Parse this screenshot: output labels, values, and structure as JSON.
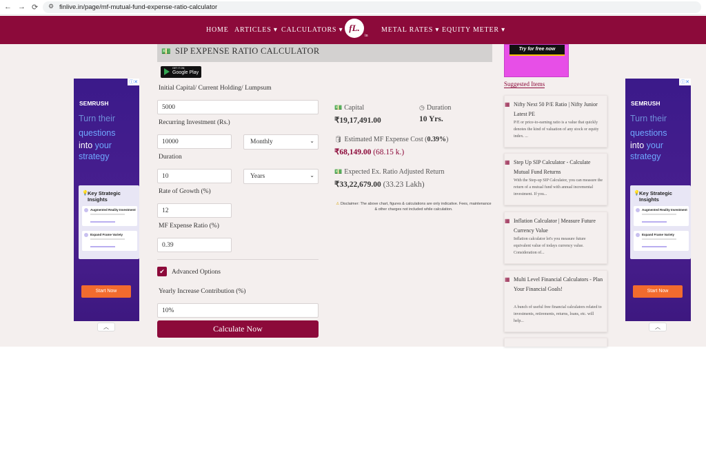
{
  "browser": {
    "url": "finlive.in/page/mf-mutual-fund-expense-ratio-calculator",
    "back": "←",
    "forward": "→",
    "reload": "⟳"
  },
  "nav": {
    "items": [
      "HOME",
      "ARTICLES ▾",
      "CALCULATORS ▾",
      "METAL RATES ▾",
      "EQUITY METER ▾"
    ],
    "logo": "fL.",
    "logo_sub": "in"
  },
  "calculator": {
    "title": "SIP EXPENSE RATIO CALCULATOR",
    "google_play_top": "GET IT ON",
    "google_play": "Google Play",
    "fields": {
      "initial_capital_label": "Initial Capital/ Current Holding/ Lumpsum",
      "initial_capital_value": "5000",
      "recurring_label": "Recurring Investment (Rs.)",
      "recurring_value": "10000",
      "recurring_frequency": "Monthly",
      "duration_label": "Duration",
      "duration_value": "10",
      "duration_unit": "Years",
      "growth_label": "Rate of Growth (%)",
      "growth_value": "12",
      "expense_label": "MF Expense Ratio (%)",
      "expense_value": "0.39",
      "advanced_label": "Advanced Options",
      "yearly_increase_label": "Yearly Increase Contribution (%)",
      "yearly_increase_value": "10%"
    },
    "calculate_label": "Calculate Now"
  },
  "results": {
    "capital_label": "Capital",
    "capital_value": "₹19,17,491.00",
    "duration_label": "Duration",
    "duration_value": "10 Yrs.",
    "expense_cost_label_prefix": "Estimated MF Expense Cost (",
    "expense_cost_pct": "0.39%",
    "expense_cost_label_suffix": ")",
    "expense_cost_value": "₹68,149.00",
    "expense_cost_short": "(68.15 k.)",
    "adjusted_label": "Expected Ex. Ratio Adjusted Return",
    "adjusted_value": "₹33,22,679.00",
    "adjusted_short": "(33.23 Lakh)",
    "disclaimer": "Disclaimer: The above chart, figures & calculations are only indicative. Fees, maintenance & other charges not included while calculation."
  },
  "ads": {
    "brand": "SEMRUSH",
    "line1": "Turn their",
    "line2": "questions",
    "line3a": "into ",
    "line3b": "your",
    "line4": "strategy",
    "card_title": "Key Strategic Insights",
    "sub1_title": "Augmented Reality Investment",
    "sub2_title": "Expand Frame Variety",
    "start": "Start Now",
    "try_free": "Try for free now",
    "colors": {
      "accent": "#6fa8ff",
      "start": "#f26b2e",
      "purple": "#3b1a8a"
    }
  },
  "suggested": {
    "heading": "Suggested Items",
    "items": [
      {
        "title": "Nifty Next 50 P/E Ratio | Nifty Junior Latest PE",
        "desc": "P/E or price-to-earning ratio is a value that quickly denotes the kind of valuation of any stock or equity index. ..."
      },
      {
        "title": "Step Up SIP Calculator - Calculate Mutual Fund Returns",
        "desc": "With the Step-up SIP Calculator, you can measure the return of a mutual fund with annual incremental investment. If you..."
      },
      {
        "title": "Inflation Calculator | Measure Future Currency Value",
        "desc": "Inflation calculator let's you measure future equivalent value of todays currency value. Consideration of..."
      },
      {
        "title": "Multi Level Financial Calculators - Plan Your Financial Goals!",
        "desc": "A bunch of useful free financial calculators related to investments, retirements, returns, loans, etc. will help..."
      }
    ]
  },
  "colors": {
    "brand": "#8c0a3a",
    "page_bg": "#f4efee"
  }
}
